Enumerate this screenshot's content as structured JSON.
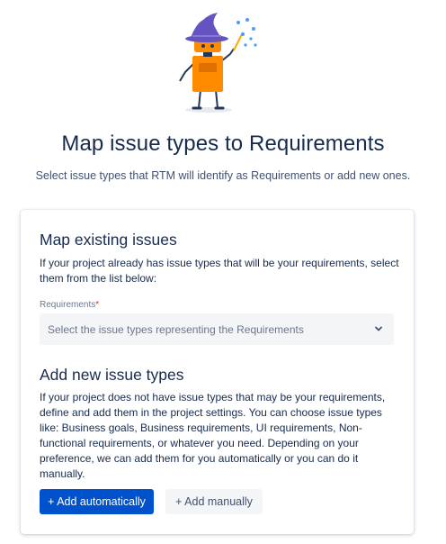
{
  "header": {
    "title": "Map issue types to Requirements",
    "subtitle": "Select issue types that RTM will identify as Requirements or add new ones."
  },
  "illustration": {
    "icon": "wizard-robot-icon"
  },
  "existing": {
    "title": "Map existing issues",
    "text": "If your project already has issue types that will be your requirements, select them from the list below:",
    "field_label": "Requirements",
    "required_mark": "*",
    "select_placeholder": "Select the issue types representing the Requirements"
  },
  "new_types": {
    "title": "Add new issue types",
    "text": "If your project does not have issue types that may be your requirements, define and add them in the project settings. You can choose issue types like: Business goals, Business requirements, UI requirements, Non-functional requirements, or whatever you need. Depending on your preference, we can add them for you automatically or you can do it manually.",
    "add_auto_label": "+ Add automatically",
    "add_manual_label": "+ Add manually"
  },
  "colors": {
    "primary": "#0052cc",
    "text": "#172b4d",
    "required": "#de350b"
  }
}
